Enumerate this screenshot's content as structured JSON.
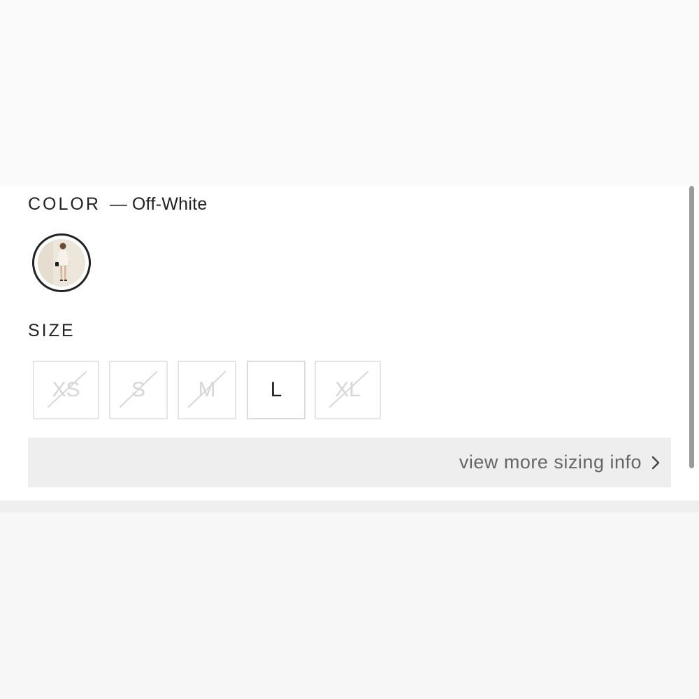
{
  "color": {
    "label": "COLOR",
    "separator": "—",
    "value": "Off-White"
  },
  "size": {
    "label": "SIZE",
    "options": [
      {
        "label": "XS",
        "available": false
      },
      {
        "label": "S",
        "available": false
      },
      {
        "label": "M",
        "available": false
      },
      {
        "label": "L",
        "available": true
      },
      {
        "label": "XL",
        "available": false
      }
    ]
  },
  "sizing_info": {
    "label": "view more sizing info",
    "icon": "chevron-right-icon"
  },
  "colors": {
    "text": "#222222",
    "muted_text": "#666666",
    "unavailable": "#d6d6d6",
    "button_bg": "#eeeeee",
    "scrollbar": "#9a9a9a"
  }
}
